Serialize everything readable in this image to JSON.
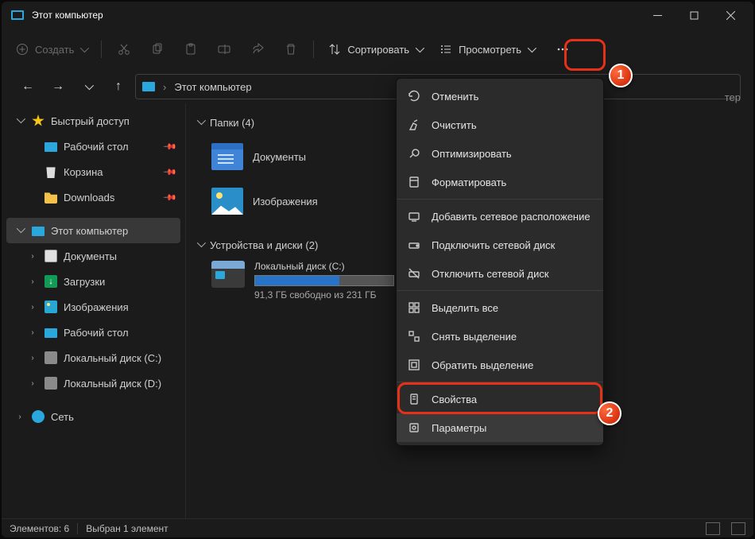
{
  "title": "Этот компьютер",
  "toolbar": {
    "new_label": "Создать",
    "sort_label": "Сортировать",
    "view_label": "Просмотреть"
  },
  "address": {
    "crumb": "Этот компьютер",
    "search_suffix": "тер"
  },
  "sidebar": {
    "quick_access": "Быстрый доступ",
    "quick_items": [
      {
        "label": "Рабочий стол",
        "icon": "monitor"
      },
      {
        "label": "Корзина",
        "icon": "bin"
      },
      {
        "label": "Downloads",
        "icon": "folder"
      }
    ],
    "this_pc": "Этот компьютер",
    "pc_items": [
      {
        "label": "Документы",
        "icon": "doc"
      },
      {
        "label": "Загрузки",
        "icon": "down"
      },
      {
        "label": "Изображения",
        "icon": "img"
      },
      {
        "label": "Рабочий стол",
        "icon": "monitor"
      },
      {
        "label": "Локальный диск (C:)",
        "icon": "disk"
      },
      {
        "label": "Локальный диск (D:)",
        "icon": "disk"
      }
    ],
    "network": "Сеть"
  },
  "content": {
    "folders_header": "Папки (4)",
    "folders": [
      {
        "label": "Документы"
      },
      {
        "label": "Изображения"
      }
    ],
    "drives_header": "Устройства и диски (2)",
    "drive": {
      "name": "Локальный диск (C:)",
      "free": "91,3 ГБ свободно из 231 ГБ"
    }
  },
  "ctx": {
    "items1": [
      {
        "label": "Отменить"
      },
      {
        "label": "Очистить"
      },
      {
        "label": "Оптимизировать"
      },
      {
        "label": "Форматировать"
      }
    ],
    "items2": [
      {
        "label": "Добавить сетевое расположение"
      },
      {
        "label": "Подключить сетевой диск"
      },
      {
        "label": "Отключить сетевой диск"
      }
    ],
    "items3": [
      {
        "label": "Выделить все"
      },
      {
        "label": "Снять выделение"
      },
      {
        "label": "Обратить выделение"
      }
    ],
    "items4": [
      {
        "label": "Свойства"
      },
      {
        "label": "Параметры"
      }
    ]
  },
  "status": {
    "count": "Элементов: 6",
    "selected": "Выбран 1 элемент"
  },
  "anno": {
    "n1": "1",
    "n2": "2"
  }
}
